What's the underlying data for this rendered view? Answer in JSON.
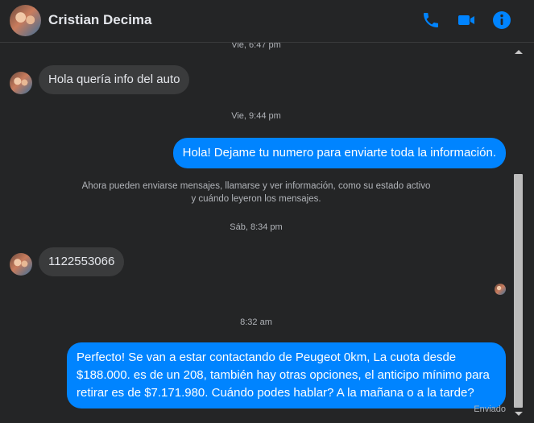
{
  "header": {
    "name": "Cristian Decima",
    "icons": [
      "phone-icon",
      "video-icon",
      "info-icon"
    ],
    "accent": "#0084ff"
  },
  "messages": {
    "ts0": "Vie, 6:47 pm",
    "in1": "Hola quería info del auto",
    "ts1": "Vie, 9:44 pm",
    "out1": "Hola! Dejame tu numero para enviarte toda la información.",
    "system": "Ahora pueden enviarse mensajes, llamarse y ver información, como su estado activo y cuándo leyeron los mensajes.",
    "ts2": "Sáb, 8:34 pm",
    "in2": "1122553066",
    "ts3": "8:32 am",
    "out2": "Perfecto!  Se van a estar contactando de Peugeot 0km, La cuota desde $188.000. es de un 208, también hay otras opciones, el anticipo mínimo para retirar es de $7.171.980. Cuándo podes hablar? A la mañana o a la tarde?",
    "status": "Enviado"
  },
  "colors": {
    "background": "#242526",
    "incoming_bubble": "#3a3b3c",
    "outgoing_bubble": "#0084ff",
    "secondary_text": "#b0b3b8"
  }
}
